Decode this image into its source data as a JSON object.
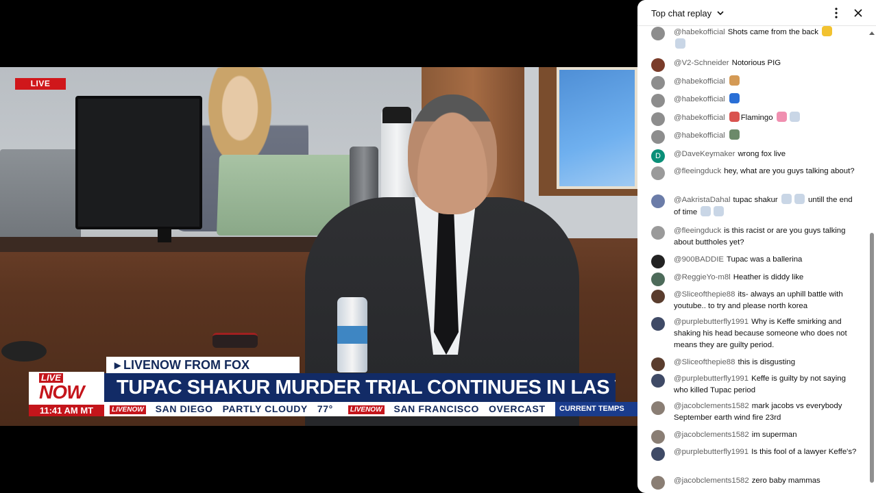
{
  "video": {
    "live_badge": "LIVE",
    "source_label": "LIVENOW FROM FOX",
    "logo_live": "LIVE",
    "logo_now": "NOW",
    "time": "11:41 AM MT",
    "headline": "TUPAC SHAKUR MURDER TRIAL CONTINUES IN LAS VEGAS",
    "ticker": {
      "brand": "LIVENOW",
      "items": [
        "SAN DIEGO",
        "PARTLY CLOUDY",
        "77°",
        "SAN FRANCISCO",
        "OVERCAST"
      ],
      "current_label": "CURRENT TEMPS"
    }
  },
  "chat": {
    "title": "Top chat replay",
    "messages": [
      {
        "author": "@habekofficial",
        "text": "Shots came from the back",
        "avatar_color": "#8d8d8d"
      },
      {
        "author": "@V2-Schneider",
        "text": "Notorious PIG",
        "avatar_color": "#7a3c2a"
      },
      {
        "author": "@habekofficial",
        "text": "",
        "avatar_color": "#8d8d8d"
      },
      {
        "author": "@habekofficial",
        "text": "",
        "avatar_color": "#8d8d8d"
      },
      {
        "author": "@habekofficial",
        "text": "Flamingo",
        "avatar_color": "#8d8d8d"
      },
      {
        "author": "@habekofficial",
        "text": "",
        "avatar_color": "#8d8d8d"
      },
      {
        "author": "@DaveKeymaker",
        "text": "wrong fox live",
        "avatar_color": "#0a8f78",
        "avatar_letter": "D"
      },
      {
        "author": "@fleeingduck",
        "text": "hey, what are you guys talking about?",
        "avatar_color": "#9a9a9a"
      },
      {
        "author": "@AakristaDahal",
        "text": "tupac shakur",
        "text2": "untill the end of time",
        "avatar_color": "#6b7ca8"
      },
      {
        "author": "@fleeingduck",
        "text": "is this racist or are you guys talking about buttholes yet?",
        "avatar_color": "#9a9a9a"
      },
      {
        "author": "@900BADDIE",
        "text": "Tupac was a ballerina",
        "avatar_color": "#222222"
      },
      {
        "author": "@ReggieYo-m8l",
        "text": "Heather is diddy like",
        "avatar_color": "#4d6b5a"
      },
      {
        "author": "@Sliceofthepie88",
        "text": "its- always an uphill battle with youtube.. to try and please north korea",
        "avatar_color": "#5a3d2e"
      },
      {
        "author": "@purplebutterfly1991",
        "text": "Why is Keffe smirking and shaking his head because someone who does not means they are guilty period.",
        "avatar_color": "#3f4a66"
      },
      {
        "author": "@Sliceofthepie88",
        "text": "this is disgusting",
        "avatar_color": "#5a3d2e"
      },
      {
        "author": "@purplebutterfly1991",
        "text": "Keffe is guilty by not saying who killed Tupac period",
        "avatar_color": "#3f4a66"
      },
      {
        "author": "@jacobclements1582",
        "text": "mark jacobs vs everybody September earth wind fire 23rd",
        "avatar_color": "#8a7e74"
      },
      {
        "author": "@jacobclements1582",
        "text": "im superman",
        "avatar_color": "#8a7e74"
      },
      {
        "author": "@purplebutterfly1991",
        "text": "Is this fool of a lawyer Keffe's?",
        "avatar_color": "#3f4a66"
      },
      {
        "author": "@jacobclements1582",
        "text": "zero baby mammas",
        "avatar_color": "#8a7e74"
      }
    ]
  },
  "colors": {
    "fox_navy": "#122b66",
    "fox_red": "#c4151b",
    "chat_author": "#606060"
  }
}
